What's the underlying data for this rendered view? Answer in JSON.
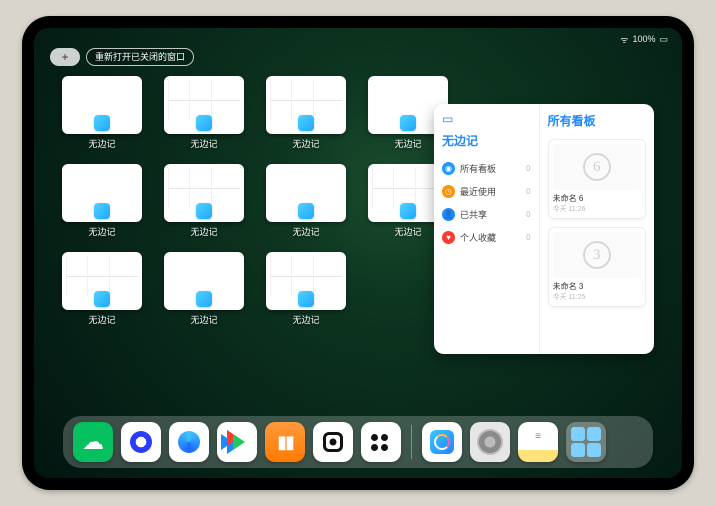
{
  "status": {
    "battery": "100%"
  },
  "topbar": {
    "plus_label": "+",
    "reopen_label": "重新打开已关闭的窗口"
  },
  "thumb_label": "无边记",
  "thumb_count": 11,
  "panel": {
    "left_title": "无边记",
    "items": [
      {
        "icon": "bubble",
        "color": "c-teal",
        "label": "所有看板",
        "count": "0"
      },
      {
        "icon": "clock",
        "color": "c-orange",
        "label": "最近使用",
        "count": "0"
      },
      {
        "icon": "person",
        "color": "c-blue",
        "label": "已共享",
        "count": "0"
      },
      {
        "icon": "heart",
        "color": "c-red",
        "label": "个人收藏",
        "count": "0"
      }
    ],
    "right_title": "所有看板",
    "boards": [
      {
        "sketch": "six",
        "title": "未命名 6",
        "sub": "今天 11:26"
      },
      {
        "sketch": "three",
        "title": "未命名 3",
        "sub": "今天 11:25"
      }
    ]
  },
  "dock": [
    {
      "name": "wechat",
      "glyph": "✳"
    },
    {
      "name": "quark",
      "glyph": ""
    },
    {
      "name": "qqbrowser",
      "glyph": ""
    },
    {
      "name": "youku",
      "glyph": ""
    },
    {
      "name": "books",
      "glyph": "▮▮"
    },
    {
      "name": "app-a",
      "glyph": ""
    },
    {
      "name": "app-b",
      "glyph": ""
    },
    {
      "name": "freeform",
      "glyph": ""
    },
    {
      "name": "settings",
      "glyph": ""
    },
    {
      "name": "notes",
      "glyph": ""
    },
    {
      "name": "folder",
      "glyph": ""
    }
  ]
}
